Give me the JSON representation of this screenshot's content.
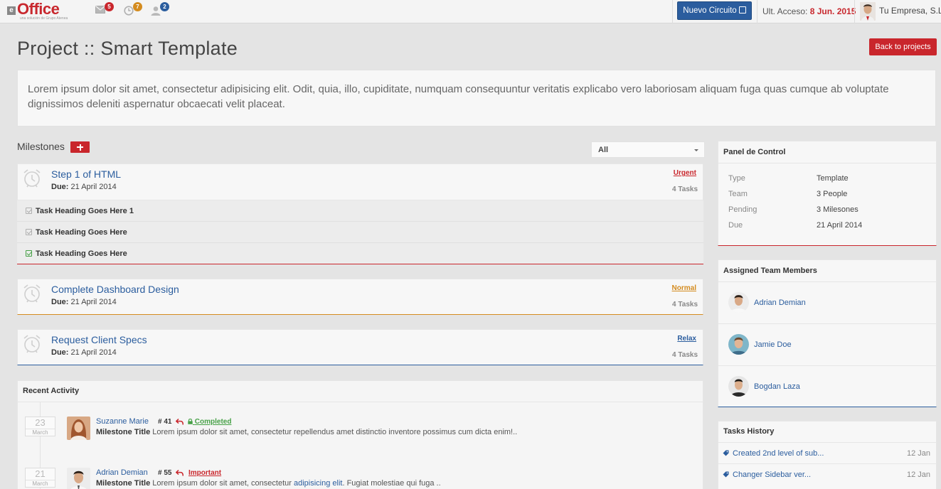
{
  "brand": {
    "logo_letter": "e",
    "logo_text": "Office",
    "logo_sub": "una solución de Grupo Atenea"
  },
  "topbar": {
    "icons": [
      {
        "name": "mail-icon",
        "count": "5",
        "color": "#c9262c"
      },
      {
        "name": "clock-icon",
        "count": "7",
        "color": "#d48b1e"
      },
      {
        "name": "user-icon",
        "count": "2",
        "color": "#2b5d9e"
      }
    ],
    "new_button": "Nuevo Circuito",
    "last_access_label": "Ult. Acceso:",
    "last_access_date": "8 Jun. 2015",
    "company": "Tu Empresa, S.L."
  },
  "page": {
    "title": "Project :: Smart Template",
    "back_button": "Back to projects",
    "description": "Lorem ipsum dolor sit amet, consectetur adipisicing elit. Odit, quia, illo, cupiditate, numquam consequuntur veritatis explicabo vero laboriosam aliquam fuga quas cumque ab voluptate dignissimos deleniti aspernatur obcaecati velit placeat."
  },
  "milestones": {
    "title": "Milestones",
    "filter": "All",
    "due_label": "Due:",
    "items": [
      {
        "name": "Step 1 of HTML",
        "due": "21 April 2014",
        "priority": "Urgent",
        "priority_color": "#c9262c",
        "tasks": "4 Tasks"
      },
      {
        "name": "Complete Dashboard Design",
        "due": "21 April 2014",
        "priority": "Normal",
        "priority_color": "#d48b1e",
        "tasks": "4 Tasks"
      },
      {
        "name": "Request Client Specs",
        "due": "21 April 2014",
        "priority": "Relax",
        "priority_color": "#2b5d9e",
        "tasks": "4 Tasks"
      }
    ],
    "tasks": [
      {
        "label": "Task Heading Goes Here 1"
      },
      {
        "label": "Task Heading Goes Here"
      },
      {
        "label": "Task Heading Goes Here"
      }
    ]
  },
  "activity": {
    "title": "Recent Activity",
    "items": [
      {
        "day": "23",
        "month": "March",
        "name": "Suzanne Marie",
        "num": "# 41",
        "status": "Completed",
        "status_color": "#46a046",
        "title": "Milestone Title",
        "text": "Lorem ipsum dolor sit amet, consectetur repellendus amet distinctio inventore possimus cum dicta enim!.."
      },
      {
        "day": "21",
        "month": "March",
        "name": "Adrian Demian",
        "num": "# 55",
        "status": "Important",
        "status_color": "#c9262c",
        "title": "Milestone Title",
        "text_pre": "Lorem ipsum dolor sit amet, consectetur",
        "text_link": "adipisicing elit",
        "text_post": ". Fugiat molestiae qui fuga .."
      }
    ]
  },
  "panel_control": {
    "title": "Panel de Control",
    "rows": [
      {
        "k": "Type",
        "v": "Template"
      },
      {
        "k": "Team",
        "v": "3 People"
      },
      {
        "k": "Pending",
        "v": "3 Milesones"
      },
      {
        "k": "Due",
        "v": "21 April 2014"
      }
    ]
  },
  "team": {
    "title": "Assigned Team Members",
    "members": [
      {
        "name": "Adrian Demian"
      },
      {
        "name": "Jamie Doe"
      },
      {
        "name": "Bogdan Laza"
      }
    ]
  },
  "history": {
    "title": "Tasks History",
    "rows": [
      {
        "text": "Created 2nd level of sub...",
        "date": "12 Jan"
      },
      {
        "text": "Changer Sidebar ver...",
        "date": "12 Jan"
      }
    ]
  },
  "colors": {
    "accent_red": "#c9262c",
    "accent_blue": "#2b5d9e",
    "accent_orange": "#d48b1e",
    "accent_green": "#46a046"
  }
}
